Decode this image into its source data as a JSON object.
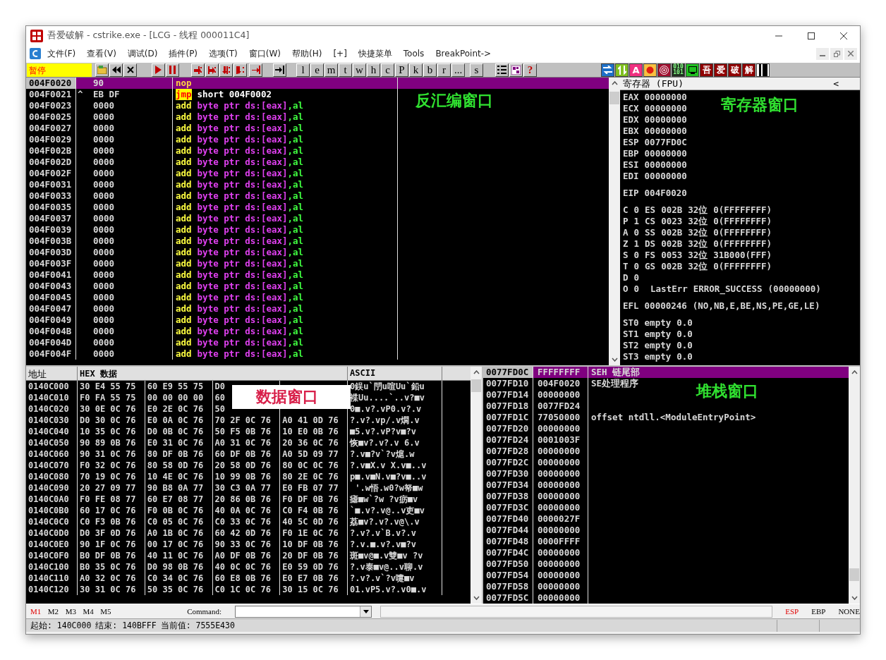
{
  "window": {
    "title": "吾爱破解 - cstrike.exe - [LCG - 线程 000011C4]"
  },
  "menu": [
    "文件(F)",
    "查看(V)",
    "调试(D)",
    "插件(P)",
    "选项(T)",
    "窗口(W)",
    "帮助(H)",
    "[+]",
    "快捷菜单",
    "Tools",
    "BreakPoint->"
  ],
  "toolbar": {
    "status": "暂停",
    "letter_buttons": [
      "l",
      "e",
      "m",
      "t",
      "w",
      "h",
      "c",
      "P",
      "k",
      "b",
      "r",
      "..."
    ],
    "extra_button": "s",
    "help_button": "?",
    "plugin_letter": "A",
    "plugin_binary": [
      "010",
      "101"
    ],
    "plugin_chars": [
      "吾",
      "爱",
      "破",
      "解"
    ]
  },
  "disassembly": {
    "annotation": "反汇编窗口",
    "rows": [
      {
        "address": "004F0020",
        "bytes": "90",
        "mnemonic": "nop",
        "kind": "normal",
        "operands": [],
        "selected": true
      },
      {
        "address": "004F0021",
        "marker": "^",
        "bytes": "EB DF",
        "mnemonic": "jmp",
        "kind": "jump",
        "operands": [
          {
            "text": "short 004F0002",
            "kind": "target"
          }
        ],
        "selected": false
      },
      {
        "address": "004F0023",
        "bytes": "0000",
        "mnemonic": "add",
        "kind": "normal",
        "operands": [
          {
            "text": "byte ptr ds:[eax]",
            "kind": "memory"
          },
          {
            "text": ",al",
            "kind": "register"
          }
        ],
        "selected": false
      },
      {
        "address": "004F0025",
        "bytes": "0000",
        "mnemonic": "add",
        "kind": "normal",
        "operands": [
          {
            "text": "byte ptr ds:[eax]",
            "kind": "memory"
          },
          {
            "text": ",al",
            "kind": "register"
          }
        ],
        "selected": false
      },
      {
        "address": "004F0027",
        "bytes": "0000",
        "mnemonic": "add",
        "kind": "normal",
        "operands": [
          {
            "text": "byte ptr ds:[eax]",
            "kind": "memory"
          },
          {
            "text": ",al",
            "kind": "register"
          }
        ],
        "selected": false
      },
      {
        "address": "004F0029",
        "bytes": "0000",
        "mnemonic": "add",
        "kind": "normal",
        "operands": [
          {
            "text": "byte ptr ds:[eax]",
            "kind": "memory"
          },
          {
            "text": ",al",
            "kind": "register"
          }
        ],
        "selected": false
      },
      {
        "address": "004F002B",
        "bytes": "0000",
        "mnemonic": "add",
        "kind": "normal",
        "operands": [
          {
            "text": "byte ptr ds:[eax]",
            "kind": "memory"
          },
          {
            "text": ",al",
            "kind": "register"
          }
        ],
        "selected": false
      },
      {
        "address": "004F002D",
        "bytes": "0000",
        "mnemonic": "add",
        "kind": "normal",
        "operands": [
          {
            "text": "byte ptr ds:[eax]",
            "kind": "memory"
          },
          {
            "text": ",al",
            "kind": "register"
          }
        ],
        "selected": false
      },
      {
        "address": "004F002F",
        "bytes": "0000",
        "mnemonic": "add",
        "kind": "normal",
        "operands": [
          {
            "text": "byte ptr ds:[eax]",
            "kind": "memory"
          },
          {
            "text": ",al",
            "kind": "register"
          }
        ],
        "selected": false
      },
      {
        "address": "004F0031",
        "bytes": "0000",
        "mnemonic": "add",
        "kind": "normal",
        "operands": [
          {
            "text": "byte ptr ds:[eax]",
            "kind": "memory"
          },
          {
            "text": ",al",
            "kind": "register"
          }
        ],
        "selected": false
      },
      {
        "address": "004F0033",
        "bytes": "0000",
        "mnemonic": "add",
        "kind": "normal",
        "operands": [
          {
            "text": "byte ptr ds:[eax]",
            "kind": "memory"
          },
          {
            "text": ",al",
            "kind": "register"
          }
        ],
        "selected": false
      },
      {
        "address": "004F0035",
        "bytes": "0000",
        "mnemonic": "add",
        "kind": "normal",
        "operands": [
          {
            "text": "byte ptr ds:[eax]",
            "kind": "memory"
          },
          {
            "text": ",al",
            "kind": "register"
          }
        ],
        "selected": false
      },
      {
        "address": "004F0037",
        "bytes": "0000",
        "mnemonic": "add",
        "kind": "normal",
        "operands": [
          {
            "text": "byte ptr ds:[eax]",
            "kind": "memory"
          },
          {
            "text": ",al",
            "kind": "register"
          }
        ],
        "selected": false
      },
      {
        "address": "004F0039",
        "bytes": "0000",
        "mnemonic": "add",
        "kind": "normal",
        "operands": [
          {
            "text": "byte ptr ds:[eax]",
            "kind": "memory"
          },
          {
            "text": ",al",
            "kind": "register"
          }
        ],
        "selected": false
      },
      {
        "address": "004F003B",
        "bytes": "0000",
        "mnemonic": "add",
        "kind": "normal",
        "operands": [
          {
            "text": "byte ptr ds:[eax]",
            "kind": "memory"
          },
          {
            "text": ",al",
            "kind": "register"
          }
        ],
        "selected": false
      },
      {
        "address": "004F003D",
        "bytes": "0000",
        "mnemonic": "add",
        "kind": "normal",
        "operands": [
          {
            "text": "byte ptr ds:[eax]",
            "kind": "memory"
          },
          {
            "text": ",al",
            "kind": "register"
          }
        ],
        "selected": false
      },
      {
        "address": "004F003F",
        "bytes": "0000",
        "mnemonic": "add",
        "kind": "normal",
        "operands": [
          {
            "text": "byte ptr ds:[eax]",
            "kind": "memory"
          },
          {
            "text": ",al",
            "kind": "register"
          }
        ],
        "selected": false
      },
      {
        "address": "004F0041",
        "bytes": "0000",
        "mnemonic": "add",
        "kind": "normal",
        "operands": [
          {
            "text": "byte ptr ds:[eax]",
            "kind": "memory"
          },
          {
            "text": ",al",
            "kind": "register"
          }
        ],
        "selected": false
      },
      {
        "address": "004F0043",
        "bytes": "0000",
        "mnemonic": "add",
        "kind": "normal",
        "operands": [
          {
            "text": "byte ptr ds:[eax]",
            "kind": "memory"
          },
          {
            "text": ",al",
            "kind": "register"
          }
        ],
        "selected": false
      },
      {
        "address": "004F0045",
        "bytes": "0000",
        "mnemonic": "add",
        "kind": "normal",
        "operands": [
          {
            "text": "byte ptr ds:[eax]",
            "kind": "memory"
          },
          {
            "text": ",al",
            "kind": "register"
          }
        ],
        "selected": false
      },
      {
        "address": "004F0047",
        "bytes": "0000",
        "mnemonic": "add",
        "kind": "normal",
        "operands": [
          {
            "text": "byte ptr ds:[eax]",
            "kind": "memory"
          },
          {
            "text": ",al",
            "kind": "register"
          }
        ],
        "selected": false
      },
      {
        "address": "004F0049",
        "bytes": "0000",
        "mnemonic": "add",
        "kind": "normal",
        "operands": [
          {
            "text": "byte ptr ds:[eax]",
            "kind": "memory"
          },
          {
            "text": ",al",
            "kind": "register"
          }
        ],
        "selected": false
      },
      {
        "address": "004F004B",
        "bytes": "0000",
        "mnemonic": "add",
        "kind": "normal",
        "operands": [
          {
            "text": "byte ptr ds:[eax]",
            "kind": "memory"
          },
          {
            "text": ",al",
            "kind": "register"
          }
        ],
        "selected": false
      },
      {
        "address": "004F004D",
        "bytes": "0000",
        "mnemonic": "add",
        "kind": "normal",
        "operands": [
          {
            "text": "byte ptr ds:[eax]",
            "kind": "memory"
          },
          {
            "text": ",al",
            "kind": "register"
          }
        ],
        "selected": false
      },
      {
        "address": "004F004F",
        "bytes": "0000",
        "mnemonic": "add",
        "kind": "normal",
        "operands": [
          {
            "text": "byte ptr ds:[eax]",
            "kind": "memory"
          },
          {
            "text": ",al",
            "kind": "register"
          }
        ],
        "selected": false
      }
    ]
  },
  "registers": {
    "title": "寄存器 (FPU)",
    "toggle": "<",
    "annotation": "寄存器窗口",
    "groups": [
      [
        [
          "EAX",
          "00000000"
        ],
        [
          "ECX",
          "00000000"
        ],
        [
          "EDX",
          "00000000"
        ],
        [
          "EBX",
          "00000000"
        ],
        [
          "ESP",
          "0077FD0C"
        ],
        [
          "EBP",
          "00000000"
        ],
        [
          "ESI",
          "00000000"
        ],
        [
          "EDI",
          "00000000"
        ]
      ],
      [
        [
          "EIP",
          "004F0020"
        ]
      ],
      [
        [
          "C",
          "0",
          "ES",
          "002B",
          "32位",
          "0(FFFFFFFF)"
        ],
        [
          "P",
          "1",
          "CS",
          "0023",
          "32位",
          "0(FFFFFFFF)"
        ],
        [
          "A",
          "0",
          "SS",
          "002B",
          "32位",
          "0(FFFFFFFF)"
        ],
        [
          "Z",
          "1",
          "DS",
          "002B",
          "32位",
          "0(FFFFFFFF)"
        ],
        [
          "S",
          "0",
          "FS",
          "0053",
          "32位",
          "31B000(FFF)"
        ],
        [
          "T",
          "0",
          "GS",
          "002B",
          "32位",
          "0(FFFFFFFF)"
        ],
        [
          "D",
          "0"
        ],
        [
          "O",
          "0",
          "LastErr",
          "ERROR_SUCCESS",
          "(00000000)"
        ]
      ],
      [
        [
          "EFL",
          "00000246",
          "(NO,NB,E,BE,NS,PE,GE,LE)"
        ]
      ],
      [
        [
          "ST0",
          "empty",
          "0.0"
        ],
        [
          "ST1",
          "empty",
          "0.0"
        ],
        [
          "ST2",
          "empty",
          "0.0"
        ],
        [
          "ST3",
          "empty",
          "0.0"
        ]
      ]
    ]
  },
  "dump": {
    "columns": [
      "地址",
      "HEX 数据",
      "ASCII"
    ],
    "annotation": "数据窗口",
    "rows": [
      {
        "address": "0140C000",
        "hex": [
          "30 E4 55 75",
          "60 E9 55 75",
          "D0"
        ],
        "ascii": "0鋘u`閅u喧Uu`鉛u"
      },
      {
        "address": "0140C010",
        "hex": [
          "F0 FA 55 75",
          "00 00 00 00",
          "60"
        ],
        "ascii": "褋Uu....`..v?■v"
      },
      {
        "address": "0140C020",
        "hex": [
          "30 0E 0C 76",
          "E0 2E 0C 76",
          "50"
        ],
        "ascii": "0■.v?.vP0.v?.v"
      },
      {
        "address": "0140C030",
        "hex": [
          "D0 30 0C 76",
          "E0 0A 0C 76",
          "70 2F 0C 76",
          "A0 41 0D 76"
        ],
        "ascii": "?.v?.vp/.v燗.v"
      },
      {
        "address": "0140C040",
        "hex": [
          "10 35 0C 76",
          "D0 0B 0C 76",
          "50 F5 0B 76",
          "10 E0 0B 76"
        ],
        "ascii": "■5.v?.vP?v■?v"
      },
      {
        "address": "0140C050",
        "hex": [
          "90 89 0B 76",
          "E0 31 0C 76",
          "A0 31 0C 76",
          "20 36 0C 76"
        ],
        "ascii": "恢■v?.v?.v 6.v"
      },
      {
        "address": "0140C060",
        "hex": [
          "90 31 0C 76",
          "80 DF 0B 76",
          "60 DF 0B 76",
          "A0 5D 09 77"
        ],
        "ascii": "?.v■?v`?v熩.w"
      },
      {
        "address": "0140C070",
        "hex": [
          "F0 32 0C 76",
          "80 58 0D 76",
          "20 58 0D 76",
          "80 0C 0C 76"
        ],
        "ascii": "?.v■X.v X.v■..v"
      },
      {
        "address": "0140C080",
        "hex": [
          "70 19 0C 76",
          "10 4E 0C 76",
          "10 99 0B 76",
          "80 2E 0C 76"
        ],
        "ascii": "p■.v■N.v■?v■..v"
      },
      {
        "address": "0140C090",
        "hex": [
          "20 27 09 77",
          "90 B8 0A 77",
          "30 C3 0A 77",
          "E0 FB 07 77"
        ],
        "ascii": " '.w悟.w0?w帑■w"
      },
      {
        "address": "0140C0A0",
        "hex": [
          "F0 FE 08 77",
          "60 E7 08 77",
          "20 86 0B 76",
          "F0 DF 0B 76"
        ],
        "ascii": "瘧■w`?w ?v疬■v"
      },
      {
        "address": "0140C0B0",
        "hex": [
          "60 17 0C 76",
          "F0 0B 0C 76",
          "40 0A 0C 76",
          "C0 F4 0B 76"
        ],
        "ascii": "`■.v?.v@..v吏■v"
      },
      {
        "address": "0140C0C0",
        "hex": [
          "C0 F3 0B 76",
          "C0 05 0C 76",
          "C0 33 0C 76",
          "40 5C 0D 76"
        ],
        "ascii": "荔■v?.v?.v@\\.v"
      },
      {
        "address": "0140C0D0",
        "hex": [
          "D0 3F 0D 76",
          "A0 1B 0C 76",
          "60 42 0D 76",
          "F0 1E 0C 76"
        ],
        "ascii": "?.v?.v`B.v?.v"
      },
      {
        "address": "0140C0E0",
        "hex": [
          "90 1F 0C 76",
          "00 17 0C 76",
          "90 33 0C 76",
          "10 DF 0B 76"
        ],
        "ascii": "?.v.■.v?.v■?v"
      },
      {
        "address": "0140C0F0",
        "hex": [
          "B0 DF 0B 76",
          "40 11 0C 76",
          "A0 DF 0B 76",
          "20 DF 0B 76"
        ],
        "ascii": "斑■v@■.v雙■v ?v"
      },
      {
        "address": "0140C100",
        "hex": [
          "B0 35 0C 76",
          "D0 98 0B 76",
          "40 0C 0C 76",
          "E0 59 0D 76"
        ],
        "ascii": "?.v泰■v@..v聊.v"
      },
      {
        "address": "0140C110",
        "hex": [
          "A0 32 0C 76",
          "C0 34 0C 76",
          "60 E8 0B 76",
          "E0 E7 0B 76"
        ],
        "ascii": "?.v?.v`?v嚏■v"
      },
      {
        "address": "0140C120",
        "hex": [
          "30 31 0C 76",
          "50 35 0C 76",
          "C0 1C 0C 76",
          "30 15 0C 76"
        ],
        "ascii": "01.vP5.v?.v0■.v"
      }
    ]
  },
  "stack": {
    "annotation": "堆栈窗口",
    "rows": [
      {
        "address": "0077FD0C",
        "value": "FFFFFFFF",
        "comment": "SEH 链尾部",
        "selected": true
      },
      {
        "address": "0077FD10",
        "value": "004F0020",
        "comment": "SE处理程序",
        "selected": false
      },
      {
        "address": "0077FD14",
        "value": "00000000",
        "selected": false
      },
      {
        "address": "0077FD18",
        "value": "0077FD24",
        "selected": false
      },
      {
        "address": "0077FD1C",
        "value": "77050000",
        "comment": "offset ntdll.<ModuleEntryPoint>",
        "selected": false
      },
      {
        "address": "0077FD20",
        "value": "00000000",
        "selected": false
      },
      {
        "address": "0077FD24",
        "value": "0001003F",
        "selected": false
      },
      {
        "address": "0077FD28",
        "value": "00000000",
        "selected": false
      },
      {
        "address": "0077FD2C",
        "value": "00000000",
        "selected": false
      },
      {
        "address": "0077FD30",
        "value": "00000000",
        "selected": false
      },
      {
        "address": "0077FD34",
        "value": "00000000",
        "selected": false
      },
      {
        "address": "0077FD38",
        "value": "00000000",
        "selected": false
      },
      {
        "address": "0077FD3C",
        "value": "00000000",
        "selected": false
      },
      {
        "address": "0077FD40",
        "value": "0000027F",
        "selected": false
      },
      {
        "address": "0077FD44",
        "value": "00000000",
        "selected": false
      },
      {
        "address": "0077FD48",
        "value": "0000FFFF",
        "selected": false
      },
      {
        "address": "0077FD4C",
        "value": "00000000",
        "selected": false
      },
      {
        "address": "0077FD50",
        "value": "00000000",
        "selected": false
      },
      {
        "address": "0077FD54",
        "value": "00000000",
        "selected": false
      },
      {
        "address": "0077FD58",
        "value": "00000000",
        "selected": false
      },
      {
        "address": "0077FD5C",
        "value": "00000000",
        "selected": false
      }
    ]
  },
  "command_bar": {
    "dump_tabs": [
      {
        "label": "M1",
        "selected": true
      },
      {
        "label": "M2",
        "selected": false
      },
      {
        "label": "M3",
        "selected": false
      },
      {
        "label": "M4",
        "selected": false
      },
      {
        "label": "M5",
        "selected": false
      }
    ],
    "command_label": "Command:",
    "stack_modes": [
      {
        "label": "ESP",
        "selected": true
      },
      {
        "label": "EBP",
        "selected": false
      },
      {
        "label": "NONE",
        "selected": false
      }
    ]
  },
  "status_bar": [
    "起始: 140C000",
    "结束: 140BFFF",
    "当前值: 7555E430"
  ]
}
